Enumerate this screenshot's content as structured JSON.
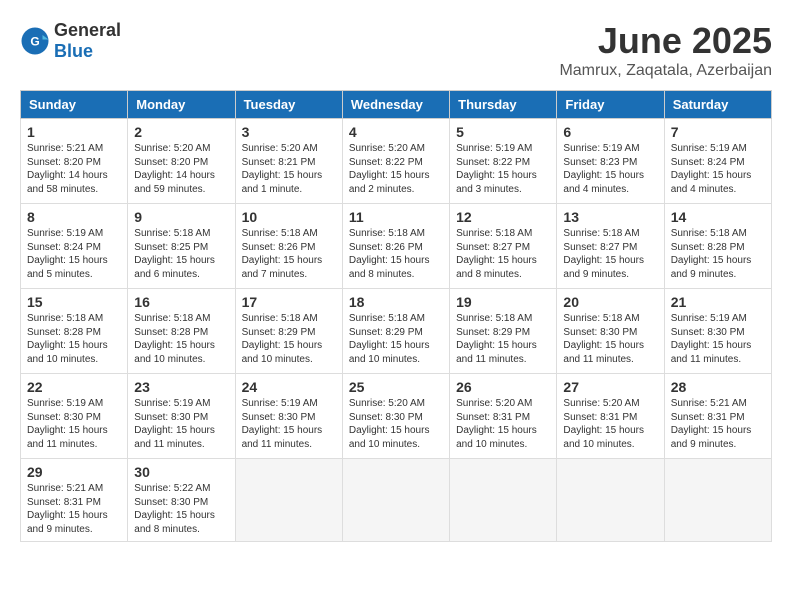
{
  "header": {
    "logo_general": "General",
    "logo_blue": "Blue",
    "month": "June 2025",
    "location": "Mamrux, Zaqatala, Azerbaijan"
  },
  "weekdays": [
    "Sunday",
    "Monday",
    "Tuesday",
    "Wednesday",
    "Thursday",
    "Friday",
    "Saturday"
  ],
  "days": [
    {
      "num": "",
      "info": ""
    },
    {
      "num": "",
      "info": ""
    },
    {
      "num": "",
      "info": ""
    },
    {
      "num": "",
      "info": ""
    },
    {
      "num": "",
      "info": ""
    },
    {
      "num": "",
      "info": ""
    },
    {
      "num": "",
      "info": ""
    },
    {
      "num": "1",
      "info": "Sunrise: 5:21 AM\nSunset: 8:20 PM\nDaylight: 14 hours\nand 58 minutes."
    },
    {
      "num": "2",
      "info": "Sunrise: 5:20 AM\nSunset: 8:20 PM\nDaylight: 14 hours\nand 59 minutes."
    },
    {
      "num": "3",
      "info": "Sunrise: 5:20 AM\nSunset: 8:21 PM\nDaylight: 15 hours\nand 1 minute."
    },
    {
      "num": "4",
      "info": "Sunrise: 5:20 AM\nSunset: 8:22 PM\nDaylight: 15 hours\nand 2 minutes."
    },
    {
      "num": "5",
      "info": "Sunrise: 5:19 AM\nSunset: 8:22 PM\nDaylight: 15 hours\nand 3 minutes."
    },
    {
      "num": "6",
      "info": "Sunrise: 5:19 AM\nSunset: 8:23 PM\nDaylight: 15 hours\nand 4 minutes."
    },
    {
      "num": "7",
      "info": "Sunrise: 5:19 AM\nSunset: 8:24 PM\nDaylight: 15 hours\nand 4 minutes."
    },
    {
      "num": "8",
      "info": "Sunrise: 5:19 AM\nSunset: 8:24 PM\nDaylight: 15 hours\nand 5 minutes."
    },
    {
      "num": "9",
      "info": "Sunrise: 5:18 AM\nSunset: 8:25 PM\nDaylight: 15 hours\nand 6 minutes."
    },
    {
      "num": "10",
      "info": "Sunrise: 5:18 AM\nSunset: 8:26 PM\nDaylight: 15 hours\nand 7 minutes."
    },
    {
      "num": "11",
      "info": "Sunrise: 5:18 AM\nSunset: 8:26 PM\nDaylight: 15 hours\nand 8 minutes."
    },
    {
      "num": "12",
      "info": "Sunrise: 5:18 AM\nSunset: 8:27 PM\nDaylight: 15 hours\nand 8 minutes."
    },
    {
      "num": "13",
      "info": "Sunrise: 5:18 AM\nSunset: 8:27 PM\nDaylight: 15 hours\nand 9 minutes."
    },
    {
      "num": "14",
      "info": "Sunrise: 5:18 AM\nSunset: 8:28 PM\nDaylight: 15 hours\nand 9 minutes."
    },
    {
      "num": "15",
      "info": "Sunrise: 5:18 AM\nSunset: 8:28 PM\nDaylight: 15 hours\nand 10 minutes."
    },
    {
      "num": "16",
      "info": "Sunrise: 5:18 AM\nSunset: 8:28 PM\nDaylight: 15 hours\nand 10 minutes."
    },
    {
      "num": "17",
      "info": "Sunrise: 5:18 AM\nSunset: 8:29 PM\nDaylight: 15 hours\nand 10 minutes."
    },
    {
      "num": "18",
      "info": "Sunrise: 5:18 AM\nSunset: 8:29 PM\nDaylight: 15 hours\nand 10 minutes."
    },
    {
      "num": "19",
      "info": "Sunrise: 5:18 AM\nSunset: 8:29 PM\nDaylight: 15 hours\nand 11 minutes."
    },
    {
      "num": "20",
      "info": "Sunrise: 5:18 AM\nSunset: 8:30 PM\nDaylight: 15 hours\nand 11 minutes."
    },
    {
      "num": "21",
      "info": "Sunrise: 5:19 AM\nSunset: 8:30 PM\nDaylight: 15 hours\nand 11 minutes."
    },
    {
      "num": "22",
      "info": "Sunrise: 5:19 AM\nSunset: 8:30 PM\nDaylight: 15 hours\nand 11 minutes."
    },
    {
      "num": "23",
      "info": "Sunrise: 5:19 AM\nSunset: 8:30 PM\nDaylight: 15 hours\nand 11 minutes."
    },
    {
      "num": "24",
      "info": "Sunrise: 5:19 AM\nSunset: 8:30 PM\nDaylight: 15 hours\nand 11 minutes."
    },
    {
      "num": "25",
      "info": "Sunrise: 5:20 AM\nSunset: 8:30 PM\nDaylight: 15 hours\nand 10 minutes."
    },
    {
      "num": "26",
      "info": "Sunrise: 5:20 AM\nSunset: 8:31 PM\nDaylight: 15 hours\nand 10 minutes."
    },
    {
      "num": "27",
      "info": "Sunrise: 5:20 AM\nSunset: 8:31 PM\nDaylight: 15 hours\nand 10 minutes."
    },
    {
      "num": "28",
      "info": "Sunrise: 5:21 AM\nSunset: 8:31 PM\nDaylight: 15 hours\nand 9 minutes."
    },
    {
      "num": "29",
      "info": "Sunrise: 5:21 AM\nSunset: 8:31 PM\nDaylight: 15 hours\nand 9 minutes."
    },
    {
      "num": "30",
      "info": "Sunrise: 5:22 AM\nSunset: 8:30 PM\nDaylight: 15 hours\nand 8 minutes."
    },
    {
      "num": "",
      "info": ""
    },
    {
      "num": "",
      "info": ""
    },
    {
      "num": "",
      "info": ""
    },
    {
      "num": "",
      "info": ""
    },
    {
      "num": "",
      "info": ""
    }
  ]
}
